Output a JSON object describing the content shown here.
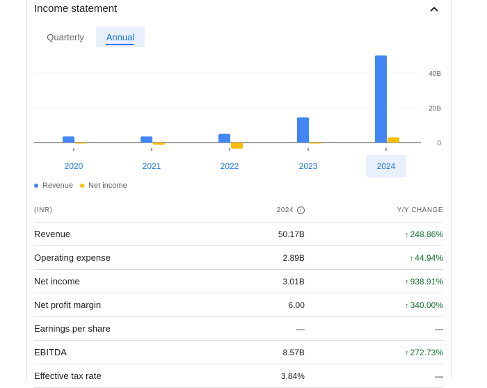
{
  "header": {
    "title": "Income statement"
  },
  "tabs": [
    {
      "label": "Quarterly"
    },
    {
      "label": "Annual"
    }
  ],
  "chart_data": {
    "type": "bar",
    "categories": [
      "2020",
      "2021",
      "2022",
      "2023",
      "2024"
    ],
    "series": [
      {
        "name": "Revenue",
        "color": "#4285f4",
        "values": [
          3.5,
          3.5,
          5.0,
          14.5,
          50.17
        ]
      },
      {
        "name": "Net income",
        "color": "#fbbc04",
        "values": [
          -0.4,
          -1.2,
          -3.5,
          -0.6,
          3.01
        ]
      }
    ],
    "y_ticks": [
      0,
      20,
      40
    ],
    "y_tick_labels": [
      "0",
      "20B",
      "40B"
    ],
    "ylim": [
      -5,
      50
    ],
    "selected_category": "2024",
    "grid": true
  },
  "legend": [
    {
      "label": "Revenue",
      "color": "#4285f4"
    },
    {
      "label": "Net income",
      "color": "#fbbc04"
    }
  ],
  "table": {
    "headers": {
      "currency": "(INR)",
      "year": "2024",
      "change": "Y/Y CHANGE"
    },
    "rows": [
      {
        "label": "Revenue",
        "value": "50.17B",
        "change": "248.86%"
      },
      {
        "label": "Operating expense",
        "value": "2.89B",
        "change": "44.94%"
      },
      {
        "label": "Net income",
        "value": "3.01B",
        "change": "938.91%"
      },
      {
        "label": "Net profit margin",
        "value": "6.00",
        "change": "340.00%"
      },
      {
        "label": "Earnings per share",
        "value": "—",
        "change": "—"
      },
      {
        "label": "EBITDA",
        "value": "8.57B",
        "change": "272.73%"
      },
      {
        "label": "Effective tax rate",
        "value": "3.84%",
        "change": "—"
      }
    ]
  }
}
